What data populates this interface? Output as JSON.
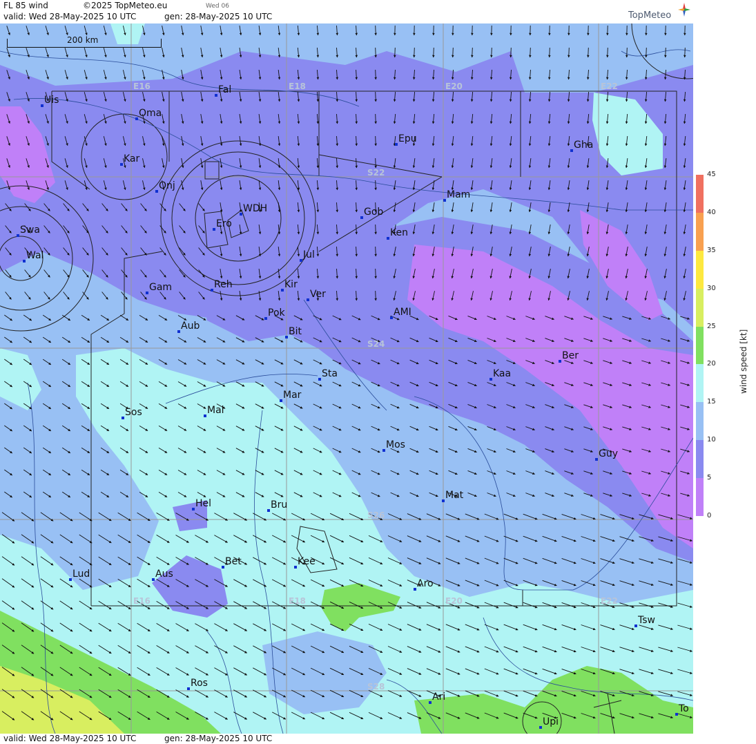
{
  "header": {
    "product": "FL 85 wind",
    "copyright": "©2025 TopMeteo.eu",
    "day_tag": "Wed 06",
    "valid": "valid:  Wed  28-May-2025  10 UTC",
    "gen": "gen: 28-May-2025 10 UTC",
    "logo": "TopMeteo"
  },
  "footer": {
    "valid": "valid:  Wed  28-May-2025  10 UTC",
    "gen": "gen: 28-May-2025 10 UTC"
  },
  "scale_bar": {
    "label": "200 km"
  },
  "grid_labels": {
    "lon_top": [
      "E16",
      "E18",
      "E20",
      "E22"
    ],
    "lon_bottom": [
      "E16",
      "E18",
      "E20",
      "E22"
    ],
    "lat": [
      "S22",
      "S24",
      "S26",
      "S28"
    ]
  },
  "places": [
    "Uis",
    "Fal",
    "Oma",
    "Kar",
    "Onj",
    "Swa",
    "Wal",
    "Gam",
    "Aub",
    "Reh",
    "Ero",
    "WDH",
    "Jul",
    "Kir",
    "Ver",
    "Pok",
    "Bit",
    "Epu",
    "Gha",
    "Mam",
    "Gob",
    "Ken",
    "AMI",
    "Sta",
    "Kaa",
    "Ber",
    "Mar",
    "Sos",
    "Mal",
    "Mos",
    "Guy",
    "Mat",
    "Hel",
    "Bru",
    "Bet",
    "Kee",
    "Lud",
    "Aus",
    "Aro",
    "Tsw",
    "Ros",
    "Ari",
    "Upi",
    "To"
  ],
  "legend": {
    "title": "wind speed [kt]",
    "ticks": [
      "45",
      "40",
      "35",
      "30",
      "25",
      "20",
      "15",
      "10",
      "5",
      "0"
    ],
    "colors": [
      "#f07060",
      "#f8a050",
      "#fde840",
      "#d8ee60",
      "#80e060",
      "#b0f4f4",
      "#98c0f4",
      "#8a8af0",
      "#c080f8"
    ]
  }
}
